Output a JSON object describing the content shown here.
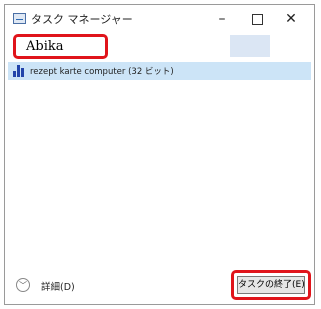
{
  "window": {
    "title": "タスク マネージャー",
    "minimize_label": "–",
    "close_label": "✕"
  },
  "search": {
    "value": "Abika"
  },
  "processes": [
    {
      "name": "rezept karte computer (32 ビット)",
      "icon": "app-bars-icon"
    }
  ],
  "footer": {
    "details_label": "詳細(D)",
    "chevron": "﹀",
    "end_task_label": "タスクの終了(E)"
  },
  "colors": {
    "highlight": "#e0141b",
    "selection": "#cce4f7"
  }
}
